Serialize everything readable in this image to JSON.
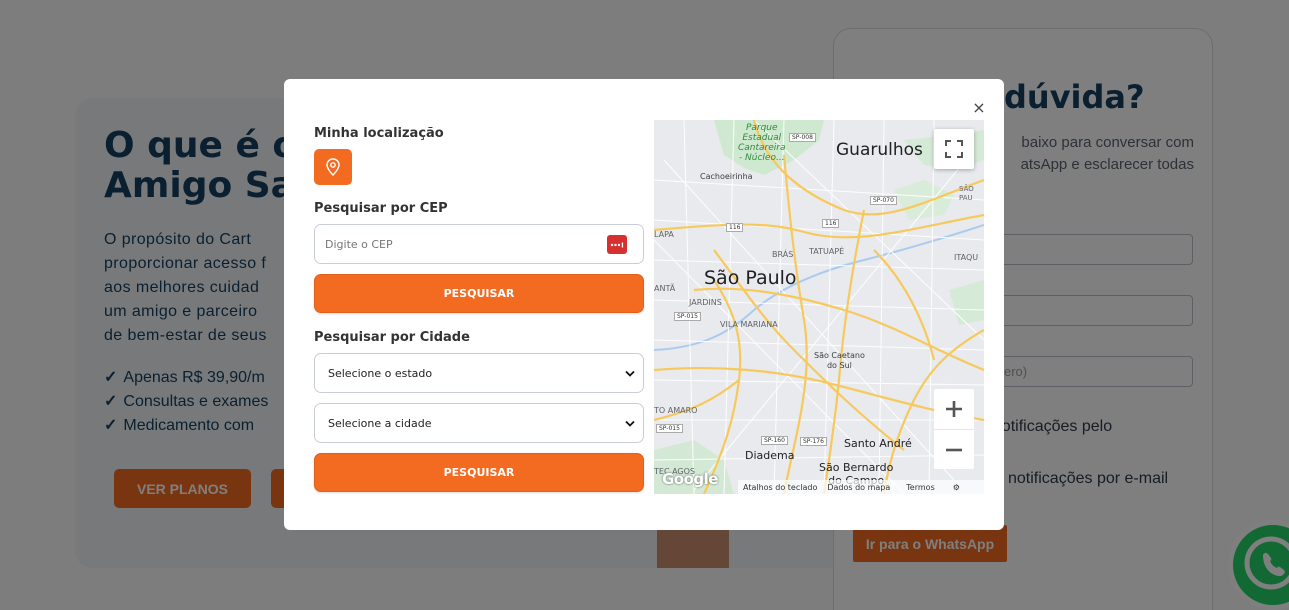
{
  "background": {
    "title": "O que é o Cartão\nAmigo Saúde?",
    "title_visible": "O que é o\nAmigo Sa",
    "description_visible": "O propósito do Cart\nproporcionar acesso f\naos melhores cuidad\num amigo e parceiro\nde bem-estar de seus",
    "benefits": [
      "Apenas R$ 39,90/m",
      "Consultas e exames",
      "Medicamento com"
    ],
    "plans_button": "VER PLANOS",
    "form_title": "dúvida?",
    "form_text": "baixo para conversar com\natsApp e esclarecer todas",
    "input_placeholder_partial": "ero)",
    "notify_whatsapp": "notificações pelo",
    "notify_email": "notificações por e-mail",
    "whatsapp_button": "Ir para o WhatsApp"
  },
  "modal": {
    "close_label": "×",
    "my_location_label": "Minha localização",
    "cep_label": "Pesquisar por CEP",
    "cep_placeholder": "Digite o CEP",
    "search_button_1": "PESQUISAR",
    "city_label": "Pesquisar por Cidade",
    "state_select": "Selecione o estado",
    "city_select": "Selecione a cidade",
    "search_button_2": "PESQUISAR"
  },
  "map": {
    "labels": {
      "guarulhos": "Guarulhos",
      "sao_paulo": "São Paulo",
      "park": "Parque\nEstadual\nCantareira\n- Núcleo...",
      "cachoeirinha": "Cachoeirinha",
      "bras": "BRÁS",
      "tatuape": "TATUAPÉ",
      "jardins": "JARDINS",
      "vila_mariana": "VILA MARIANA",
      "sao_caetano": "São Caetano\ndo Sul",
      "santo_andre": "Santo André",
      "diadema": "Diadema",
      "sao_bernardo": "São Bernardo\ndo Campo",
      "lapa": "LAPA",
      "anta": "ANTÃ",
      "to_amaro": "TO AMARO",
      "itaqu": "ITAQU",
      "sao": "SÃO\nPAU",
      "tecagos": "TEC AGOS",
      "sp008": "SP-008",
      "sp070": "SP-070",
      "sp015a": "SP-015",
      "sp015b": "SP-015",
      "sp160": "SP-160",
      "sp176": "SP-176",
      "r116a": "116",
      "r116b": "116"
    },
    "footer": {
      "shortcuts": "Atalhos do teclado",
      "map_data": "Dados do mapa",
      "terms": "Termos"
    },
    "logo": "Google"
  },
  "colors": {
    "accent": "#f36b21",
    "navy": "#143e5e",
    "cep_icon": "#d6312e"
  }
}
